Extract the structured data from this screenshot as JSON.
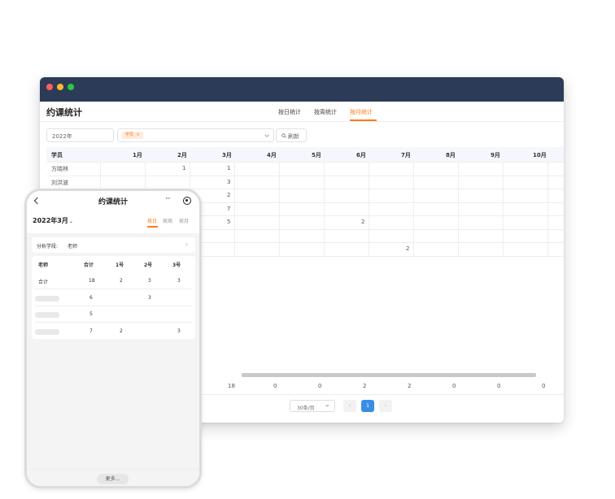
{
  "desktop": {
    "title": "约课统计",
    "tabs": [
      {
        "label": "按日统计",
        "active": false
      },
      {
        "label": "按周统计",
        "active": false
      },
      {
        "label": "按月统计",
        "active": true
      }
    ],
    "filters": {
      "year_value": "2022年",
      "field_tag": "学员",
      "tag_close": "×",
      "refresh_label": "刷新"
    },
    "table": {
      "headers": [
        "学员",
        "1月",
        "2月",
        "3月",
        "4月",
        "5月",
        "6月",
        "7月",
        "8月",
        "9月",
        "10月"
      ],
      "rows": [
        {
          "name": "方晓林",
          "values": [
            "",
            "1",
            "1",
            "",
            "",
            "",
            "",
            "",
            "",
            ""
          ]
        },
        {
          "name": "刘洪波",
          "values": [
            "",
            "",
            "3",
            "",
            "",
            "",
            "",
            "",
            "",
            ""
          ]
        },
        {
          "name": "",
          "values": [
            "",
            "",
            "2",
            "",
            "",
            "",
            "",
            "",
            "",
            ""
          ]
        },
        {
          "name": "",
          "values": [
            "",
            "",
            "7",
            "",
            "",
            "",
            "",
            "",
            "",
            ""
          ]
        },
        {
          "name": "",
          "values": [
            "",
            "",
            "5",
            "",
            "",
            "2",
            "",
            "",
            "",
            ""
          ]
        },
        {
          "name": "",
          "values": [
            "",
            "",
            "",
            "",
            "",
            "",
            "",
            "",
            "",
            ""
          ]
        },
        {
          "name": "",
          "values": [
            "",
            "",
            "",
            "",
            "",
            "",
            "2",
            "",
            "",
            ""
          ]
        }
      ],
      "totals": [
        "18",
        "0",
        "0",
        "2",
        "2",
        "0",
        "0",
        "0"
      ]
    },
    "pagination": {
      "page_size": "30条/页",
      "prev": "‹",
      "current": "1",
      "next": "›"
    },
    "colors": {
      "titlebar": "#2c3b57",
      "accent": "#ff7a1a",
      "page_active": "#3a8ee6"
    }
  },
  "phone": {
    "title": "约课统计",
    "more_icon": "···",
    "month": "2022年3月",
    "month_chevron": "⌄",
    "tabs": [
      {
        "label": "按日",
        "active": true
      },
      {
        "label": "按周",
        "active": false
      },
      {
        "label": "按月",
        "active": false
      }
    ],
    "dimension_label": "分析学段:",
    "dimension_value": "老师",
    "dimension_arrow": "›",
    "table": {
      "headers": [
        "老师",
        "合计",
        "1号",
        "2号",
        "3号"
      ],
      "rows": [
        {
          "name": "合计",
          "values": [
            "18",
            "2",
            "3",
            "3"
          ]
        },
        {
          "name": "",
          "values": [
            "6",
            "",
            "3",
            ""
          ]
        },
        {
          "name": "",
          "values": [
            "5",
            "",
            "",
            ""
          ]
        },
        {
          "name": "",
          "values": [
            "7",
            "2",
            "",
            "3"
          ]
        }
      ]
    },
    "more_button": "更多..."
  }
}
